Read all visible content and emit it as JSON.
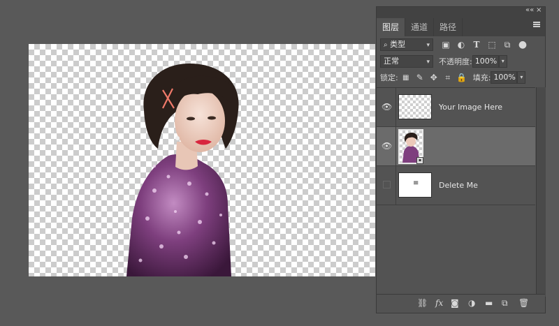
{
  "panel": {
    "collapse_label": "««",
    "close_label": "×",
    "tabs": [
      {
        "label": "图层"
      },
      {
        "label": "通道"
      },
      {
        "label": "路径"
      }
    ],
    "filter": {
      "kind_label": "类型"
    },
    "blend_mode": "正常",
    "opacity": {
      "label": "不透明度:",
      "value": "100%"
    },
    "lock_label": "锁定:",
    "fill": {
      "label": "填充:",
      "value": "100%"
    },
    "layers": [
      {
        "name": "Your Image Here",
        "visible": true,
        "selected": false
      },
      {
        "name": "",
        "visible": true,
        "selected": true
      },
      {
        "name": "Delete Me",
        "visible": false,
        "selected": false
      }
    ],
    "bottom_icons": [
      "link-icon",
      "fx-icon",
      "mask-icon",
      "adjustment-icon",
      "folder-icon",
      "new-layer-icon",
      "trash-icon"
    ]
  },
  "colors": {
    "background": "#595959",
    "panel": "#535353",
    "selected_layer": "#6b6b6b"
  }
}
